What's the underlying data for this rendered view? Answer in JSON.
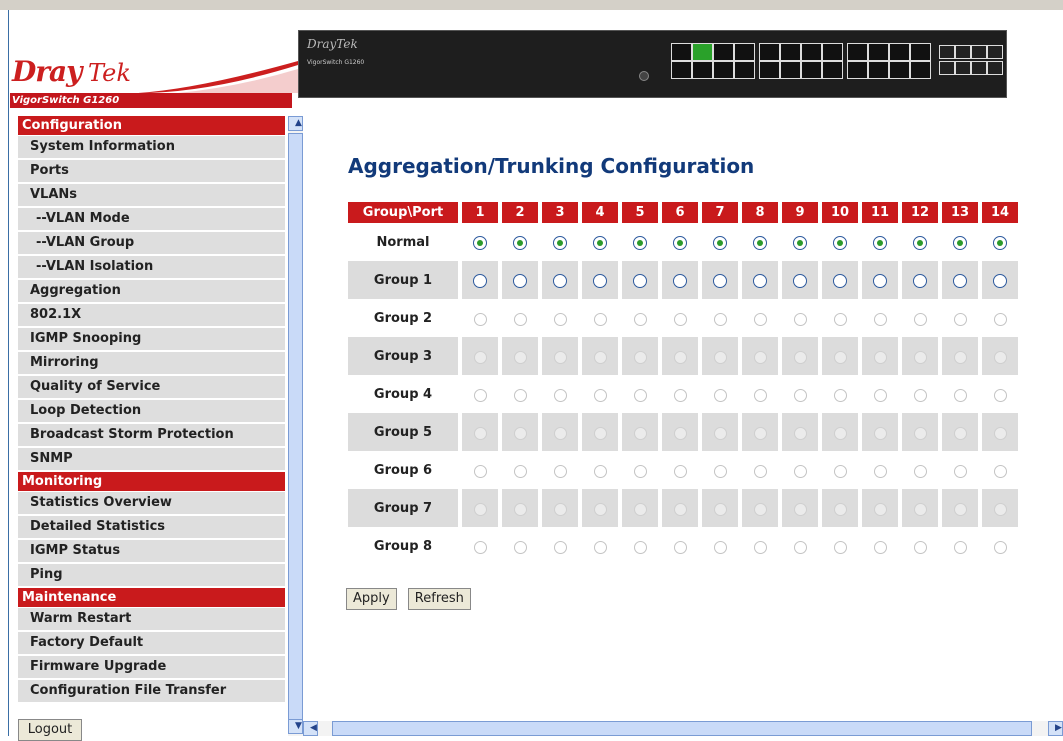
{
  "header": {
    "brand_dray": "Dray",
    "brand_tek": "Tek",
    "model": "VigorSwitch G1260",
    "device_brand": "DrayTek",
    "device_model": "VigorSwitch G1260"
  },
  "sidebar": {
    "sections": [
      {
        "title": "Configuration",
        "items": [
          {
            "label": "System Information"
          },
          {
            "label": "Ports"
          },
          {
            "label": "VLANs"
          },
          {
            "label": "--VLAN Mode",
            "sub": true
          },
          {
            "label": "--VLAN Group",
            "sub": true
          },
          {
            "label": "--VLAN Isolation",
            "sub": true
          },
          {
            "label": "Aggregation"
          },
          {
            "label": "802.1X"
          },
          {
            "label": "IGMP Snooping"
          },
          {
            "label": "Mirroring"
          },
          {
            "label": "Quality of Service"
          },
          {
            "label": "Loop Detection"
          },
          {
            "label": "Broadcast Storm Protection"
          },
          {
            "label": "SNMP"
          }
        ]
      },
      {
        "title": "Monitoring",
        "items": [
          {
            "label": "Statistics Overview"
          },
          {
            "label": "Detailed Statistics"
          },
          {
            "label": "IGMP Status"
          },
          {
            "label": "Ping"
          }
        ]
      },
      {
        "title": "Maintenance",
        "items": [
          {
            "label": "Warm Restart"
          },
          {
            "label": "Factory Default"
          },
          {
            "label": "Firmware Upgrade"
          },
          {
            "label": "Configuration File Transfer"
          }
        ]
      }
    ],
    "logout_label": "Logout"
  },
  "main": {
    "title": "Aggregation/Trunking Configuration",
    "corner_header": "Group\\Port",
    "ports": [
      "1",
      "2",
      "3",
      "4",
      "5",
      "6",
      "7",
      "8",
      "9",
      "10",
      "11",
      "12",
      "13",
      "14"
    ],
    "rows": [
      {
        "label": "Normal",
        "checked": true,
        "enabled": true
      },
      {
        "label": "Group 1",
        "checked": false,
        "enabled": true
      },
      {
        "label": "Group 2",
        "checked": false,
        "enabled": false
      },
      {
        "label": "Group 3",
        "checked": false,
        "enabled": false
      },
      {
        "label": "Group 4",
        "checked": false,
        "enabled": false
      },
      {
        "label": "Group 5",
        "checked": false,
        "enabled": false
      },
      {
        "label": "Group 6",
        "checked": false,
        "enabled": false
      },
      {
        "label": "Group 7",
        "checked": false,
        "enabled": false
      },
      {
        "label": "Group 8",
        "checked": false,
        "enabled": false
      }
    ],
    "apply_label": "Apply",
    "refresh_label": "Refresh"
  },
  "colors": {
    "accent_red": "#c91a1c",
    "title_blue": "#123a7a",
    "checked_green": "#2b9a2b"
  }
}
